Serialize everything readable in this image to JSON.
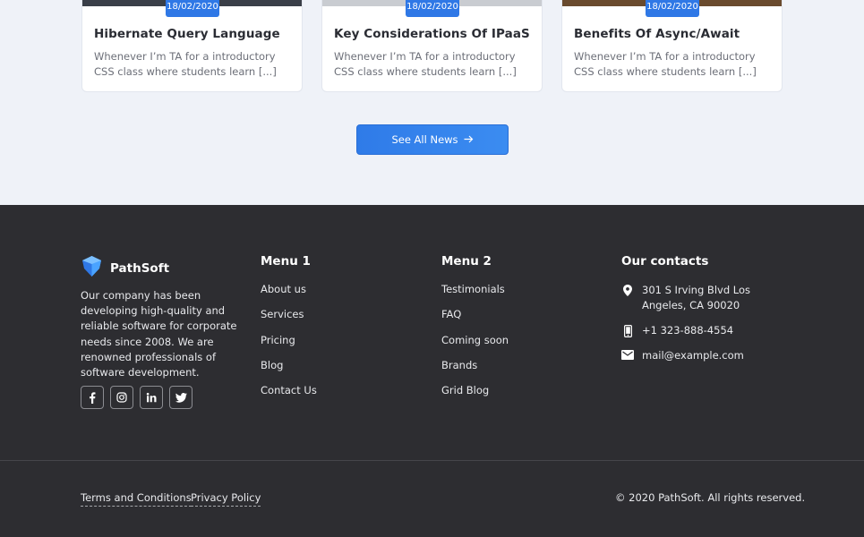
{
  "news": {
    "cards": [
      {
        "date": "18/02/2020",
        "title": "Hibernate Query Language",
        "excerpt": "Whenever I’m TA for a introductory CSS class where students learn [...]"
      },
      {
        "date": "18/02/2020",
        "title": "Key Considerations Of IPaaS",
        "excerpt": "Whenever I’m TA for a introductory CSS class where students learn [...]"
      },
      {
        "date": "18/02/2020",
        "title": "Benefits Of Async/Await",
        "excerpt": "Whenever I’m TA for a introductory CSS class where students learn [...]"
      }
    ],
    "see_all_label": "See All News",
    "see_all_icon": "arrow-right-icon"
  },
  "footer": {
    "brand": {
      "name": "PathSoft",
      "logo_icon": "shield-logo-icon",
      "accent": "#2f78e6"
    },
    "about": "Our company has been developing high-quality and reliable software for corporate needs since 2008. We are renowned professionals of software development.",
    "socials": [
      {
        "name": "facebook-icon",
        "glyph": "f"
      },
      {
        "name": "instagram-icon",
        "glyph": ""
      },
      {
        "name": "linkedin-icon",
        "glyph": "in"
      },
      {
        "name": "twitter-icon",
        "glyph": ""
      }
    ],
    "menu1": {
      "title": "Menu 1",
      "items": [
        "About us",
        "Services",
        "Pricing",
        "Blog",
        "Contact Us"
      ]
    },
    "menu2": {
      "title": "Menu 2",
      "items": [
        "Testimonials",
        "FAQ",
        "Coming soon",
        "Brands",
        "Grid Blog"
      ]
    },
    "contacts": {
      "title": "Our contacts",
      "address": "301 S Irving Blvd Los Angeles, CA 90020",
      "phone": "+1 323-888-4554",
      "email": "mail@example.com"
    },
    "legal": {
      "terms": "Terms and Conditions",
      "privacy": "Privacy Policy"
    },
    "copyright": "© 2020 PathSoft. All rights reserved."
  }
}
